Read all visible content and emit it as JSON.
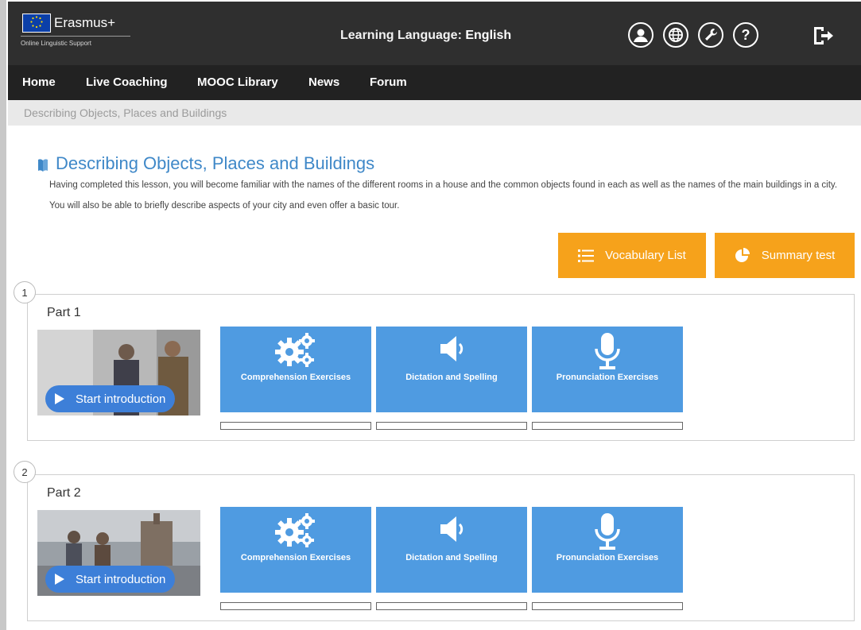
{
  "header": {
    "brand": "Erasmus+",
    "brand_sub": "Online Linguistic Support",
    "language_label": "Learning Language: ",
    "language_value": "English",
    "icons": [
      "profile-icon",
      "globe-icon",
      "wrench-icon",
      "help-icon",
      "logout-icon"
    ]
  },
  "nav": {
    "items": [
      {
        "label": "Home"
      },
      {
        "label": "Live Coaching"
      },
      {
        "label": "MOOC Library"
      },
      {
        "label": "News"
      },
      {
        "label": "Forum"
      }
    ]
  },
  "breadcrumb": "Describing Objects, Places and Buildings",
  "lesson": {
    "title": "Describing Objects, Places and Buildings",
    "description": "Having completed this lesson, you will become familiar with the names of the different rooms in a house and the common objects found in each as well as the names of the main buildings in a city. You will also be able to briefly describe aspects of your city and even offer a basic tour."
  },
  "buttons": {
    "vocabulary": "Vocabulary List",
    "summary": "Summary test"
  },
  "parts": [
    {
      "number": "1",
      "label": "Part 1",
      "start": "Start introduction",
      "tiles": [
        "Comprehension Exercises",
        "Dictation and Spelling",
        "Pronunciation Exercises"
      ],
      "progress": [
        0,
        0,
        0
      ]
    },
    {
      "number": "2",
      "label": "Part 2",
      "start": "Start introduction",
      "tiles": [
        "Comprehension Exercises",
        "Dictation and Spelling",
        "Pronunciation Exercises"
      ],
      "progress": [
        0,
        0,
        0
      ]
    }
  ],
  "colors": {
    "header_bg": "#2f2f2f",
    "nav_bg": "#222222",
    "accent_blue": "#4f9be1",
    "title_blue": "#3f88c8",
    "orange": "#f6a21b"
  }
}
